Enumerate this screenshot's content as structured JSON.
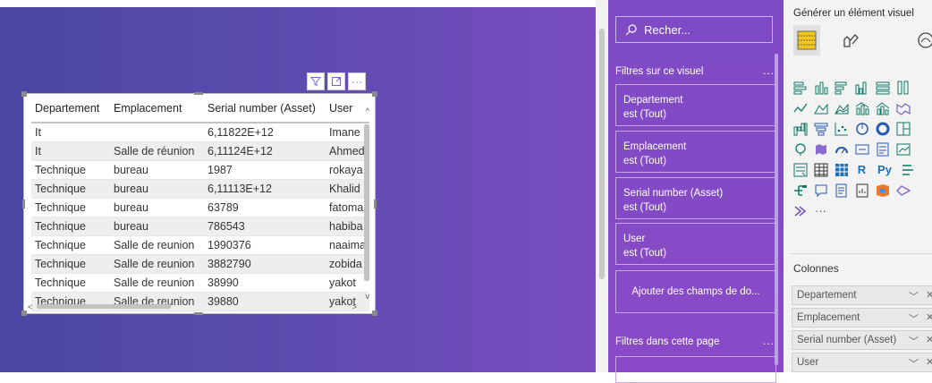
{
  "visual_header": {
    "filter_icon": "filter-icon",
    "focus_icon": "focus-mode-icon",
    "more_label": "···"
  },
  "table": {
    "columns": [
      "Departement",
      "Emplacement",
      "Serial number (Asset)",
      "User"
    ],
    "rows": [
      [
        "It",
        "",
        "6,11822E+12",
        "Imane"
      ],
      [
        "It",
        "Salle de réunion",
        "6,11124E+12",
        "Ahmed"
      ],
      [
        "Technique",
        "bureau",
        "1987",
        "rokaya"
      ],
      [
        "Technique",
        "bureau",
        "6,11113E+12",
        "Khalid"
      ],
      [
        "Technique",
        "bureau",
        "63789",
        "fatoma"
      ],
      [
        "Technique",
        "bureau",
        "786543",
        "habiba"
      ],
      [
        "Technique",
        "Salle de reunion",
        "1990376",
        "naaima"
      ],
      [
        "Technique",
        "Salle de reunion",
        "3882790",
        "zobida"
      ],
      [
        "Technique",
        "Salle de reunion",
        "38990",
        "yakot"
      ],
      [
        "Technique",
        "Salle de reunion",
        "39880",
        "yakot"
      ]
    ]
  },
  "filters": {
    "search_placeholder": "Recher...",
    "visual_section": "Filtres sur ce visuel",
    "more": "...",
    "cards": [
      {
        "name": "Departement",
        "state": "est (Tout)"
      },
      {
        "name": "Emplacement",
        "state": "est (Tout)"
      },
      {
        "name": "Serial number (Asset)",
        "state": "est (Tout)"
      },
      {
        "name": "User",
        "state": "est (Tout)"
      }
    ],
    "add_fields": "Ajouter des champs de do...",
    "page_section": "Filtres dans cette page"
  },
  "viz": {
    "title": "Générer un élément visuel",
    "ellipsis": "···",
    "columns_title": "Colonnes",
    "fields": [
      "Departement",
      "Emplacement",
      "Serial number (Asset)",
      "User"
    ],
    "r_label": "R",
    "py_label": "Py"
  }
}
